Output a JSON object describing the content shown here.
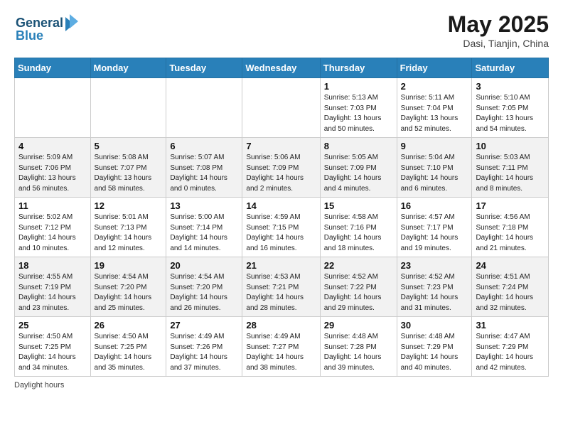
{
  "header": {
    "logo_line1": "General",
    "logo_line2": "Blue",
    "title": "May 2025",
    "subtitle": "Dasi, Tianjin, China"
  },
  "days_of_week": [
    "Sunday",
    "Monday",
    "Tuesday",
    "Wednesday",
    "Thursday",
    "Friday",
    "Saturday"
  ],
  "weeks": [
    [
      {
        "day": "",
        "detail": ""
      },
      {
        "day": "",
        "detail": ""
      },
      {
        "day": "",
        "detail": ""
      },
      {
        "day": "",
        "detail": ""
      },
      {
        "day": "1",
        "detail": "Sunrise: 5:13 AM\nSunset: 7:03 PM\nDaylight: 13 hours\nand 50 minutes."
      },
      {
        "day": "2",
        "detail": "Sunrise: 5:11 AM\nSunset: 7:04 PM\nDaylight: 13 hours\nand 52 minutes."
      },
      {
        "day": "3",
        "detail": "Sunrise: 5:10 AM\nSunset: 7:05 PM\nDaylight: 13 hours\nand 54 minutes."
      }
    ],
    [
      {
        "day": "4",
        "detail": "Sunrise: 5:09 AM\nSunset: 7:06 PM\nDaylight: 13 hours\nand 56 minutes."
      },
      {
        "day": "5",
        "detail": "Sunrise: 5:08 AM\nSunset: 7:07 PM\nDaylight: 13 hours\nand 58 minutes."
      },
      {
        "day": "6",
        "detail": "Sunrise: 5:07 AM\nSunset: 7:08 PM\nDaylight: 14 hours\nand 0 minutes."
      },
      {
        "day": "7",
        "detail": "Sunrise: 5:06 AM\nSunset: 7:09 PM\nDaylight: 14 hours\nand 2 minutes."
      },
      {
        "day": "8",
        "detail": "Sunrise: 5:05 AM\nSunset: 7:09 PM\nDaylight: 14 hours\nand 4 minutes."
      },
      {
        "day": "9",
        "detail": "Sunrise: 5:04 AM\nSunset: 7:10 PM\nDaylight: 14 hours\nand 6 minutes."
      },
      {
        "day": "10",
        "detail": "Sunrise: 5:03 AM\nSunset: 7:11 PM\nDaylight: 14 hours\nand 8 minutes."
      }
    ],
    [
      {
        "day": "11",
        "detail": "Sunrise: 5:02 AM\nSunset: 7:12 PM\nDaylight: 14 hours\nand 10 minutes."
      },
      {
        "day": "12",
        "detail": "Sunrise: 5:01 AM\nSunset: 7:13 PM\nDaylight: 14 hours\nand 12 minutes."
      },
      {
        "day": "13",
        "detail": "Sunrise: 5:00 AM\nSunset: 7:14 PM\nDaylight: 14 hours\nand 14 minutes."
      },
      {
        "day": "14",
        "detail": "Sunrise: 4:59 AM\nSunset: 7:15 PM\nDaylight: 14 hours\nand 16 minutes."
      },
      {
        "day": "15",
        "detail": "Sunrise: 4:58 AM\nSunset: 7:16 PM\nDaylight: 14 hours\nand 18 minutes."
      },
      {
        "day": "16",
        "detail": "Sunrise: 4:57 AM\nSunset: 7:17 PM\nDaylight: 14 hours\nand 19 minutes."
      },
      {
        "day": "17",
        "detail": "Sunrise: 4:56 AM\nSunset: 7:18 PM\nDaylight: 14 hours\nand 21 minutes."
      }
    ],
    [
      {
        "day": "18",
        "detail": "Sunrise: 4:55 AM\nSunset: 7:19 PM\nDaylight: 14 hours\nand 23 minutes."
      },
      {
        "day": "19",
        "detail": "Sunrise: 4:54 AM\nSunset: 7:20 PM\nDaylight: 14 hours\nand 25 minutes."
      },
      {
        "day": "20",
        "detail": "Sunrise: 4:54 AM\nSunset: 7:20 PM\nDaylight: 14 hours\nand 26 minutes."
      },
      {
        "day": "21",
        "detail": "Sunrise: 4:53 AM\nSunset: 7:21 PM\nDaylight: 14 hours\nand 28 minutes."
      },
      {
        "day": "22",
        "detail": "Sunrise: 4:52 AM\nSunset: 7:22 PM\nDaylight: 14 hours\nand 29 minutes."
      },
      {
        "day": "23",
        "detail": "Sunrise: 4:52 AM\nSunset: 7:23 PM\nDaylight: 14 hours\nand 31 minutes."
      },
      {
        "day": "24",
        "detail": "Sunrise: 4:51 AM\nSunset: 7:24 PM\nDaylight: 14 hours\nand 32 minutes."
      }
    ],
    [
      {
        "day": "25",
        "detail": "Sunrise: 4:50 AM\nSunset: 7:25 PM\nDaylight: 14 hours\nand 34 minutes."
      },
      {
        "day": "26",
        "detail": "Sunrise: 4:50 AM\nSunset: 7:25 PM\nDaylight: 14 hours\nand 35 minutes."
      },
      {
        "day": "27",
        "detail": "Sunrise: 4:49 AM\nSunset: 7:26 PM\nDaylight: 14 hours\nand 37 minutes."
      },
      {
        "day": "28",
        "detail": "Sunrise: 4:49 AM\nSunset: 7:27 PM\nDaylight: 14 hours\nand 38 minutes."
      },
      {
        "day": "29",
        "detail": "Sunrise: 4:48 AM\nSunset: 7:28 PM\nDaylight: 14 hours\nand 39 minutes."
      },
      {
        "day": "30",
        "detail": "Sunrise: 4:48 AM\nSunset: 7:29 PM\nDaylight: 14 hours\nand 40 minutes."
      },
      {
        "day": "31",
        "detail": "Sunrise: 4:47 AM\nSunset: 7:29 PM\nDaylight: 14 hours\nand 42 minutes."
      }
    ]
  ],
  "footer": {
    "note": "Daylight hours"
  },
  "colors": {
    "header_bg": "#2980b9",
    "logo_dark": "#1a5276",
    "logo_light": "#2980b9"
  }
}
